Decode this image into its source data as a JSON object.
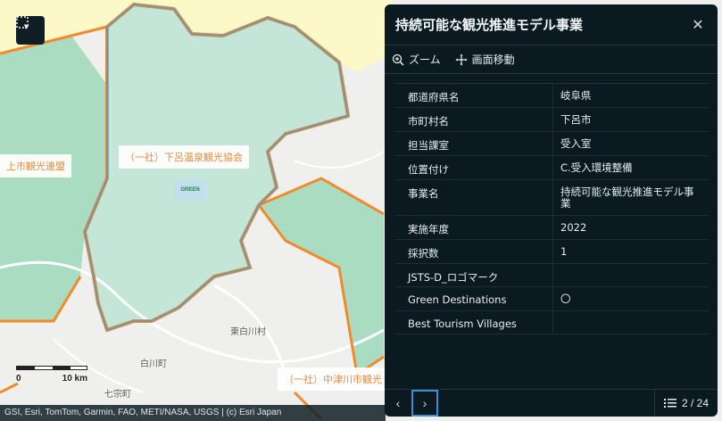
{
  "map": {
    "labels": {
      "left_org": "上市観光連盟",
      "center_org": "（一社）下呂温泉観光協会",
      "bottom_org": "（一社）中津川市観光"
    },
    "towns": {
      "higashishirakawa": "東白川村",
      "shirakawa": "白川町",
      "shichiso": "七宗町"
    },
    "scale": {
      "start": "0",
      "end": "10 km"
    },
    "attribution": "GSI, Esri, TomTom, Garmin, FAO, METI/NASA, USGS | (c) Esri Japan",
    "logo_text": "GREEN"
  },
  "panel": {
    "title": "持続可能な観光推進モデル事業",
    "actions": {
      "zoom": "ズーム",
      "pan": "画面移動"
    },
    "rows": [
      {
        "key": "都道府県名",
        "value": "岐阜県"
      },
      {
        "key": "市町村名",
        "value": "下呂市"
      },
      {
        "key": "担当課室",
        "value": "受入室"
      },
      {
        "key": "位置付け",
        "value": "C.受入環境整備"
      },
      {
        "key": "事業名",
        "value": "持続可能な観光推進モデル事業"
      },
      {
        "key": "実施年度",
        "value": "2022"
      },
      {
        "key": "採択数",
        "value": "1"
      },
      {
        "key": "JSTS-D_ロゴマーク",
        "value": ""
      },
      {
        "key": "Green Destinations",
        "value": "〇"
      },
      {
        "key": "Best Tourism Villages",
        "value": ""
      }
    ],
    "pager": "2 / 24"
  },
  "colors": {
    "panel_bg": "#0b1a20",
    "region_green": "#c4e6d9",
    "region_darkgreen": "#a9dcc0",
    "boundary_orange": "#f08a2a",
    "boundary_blue": "#6a9ab6",
    "yellow_area": "#fdf8c8"
  }
}
